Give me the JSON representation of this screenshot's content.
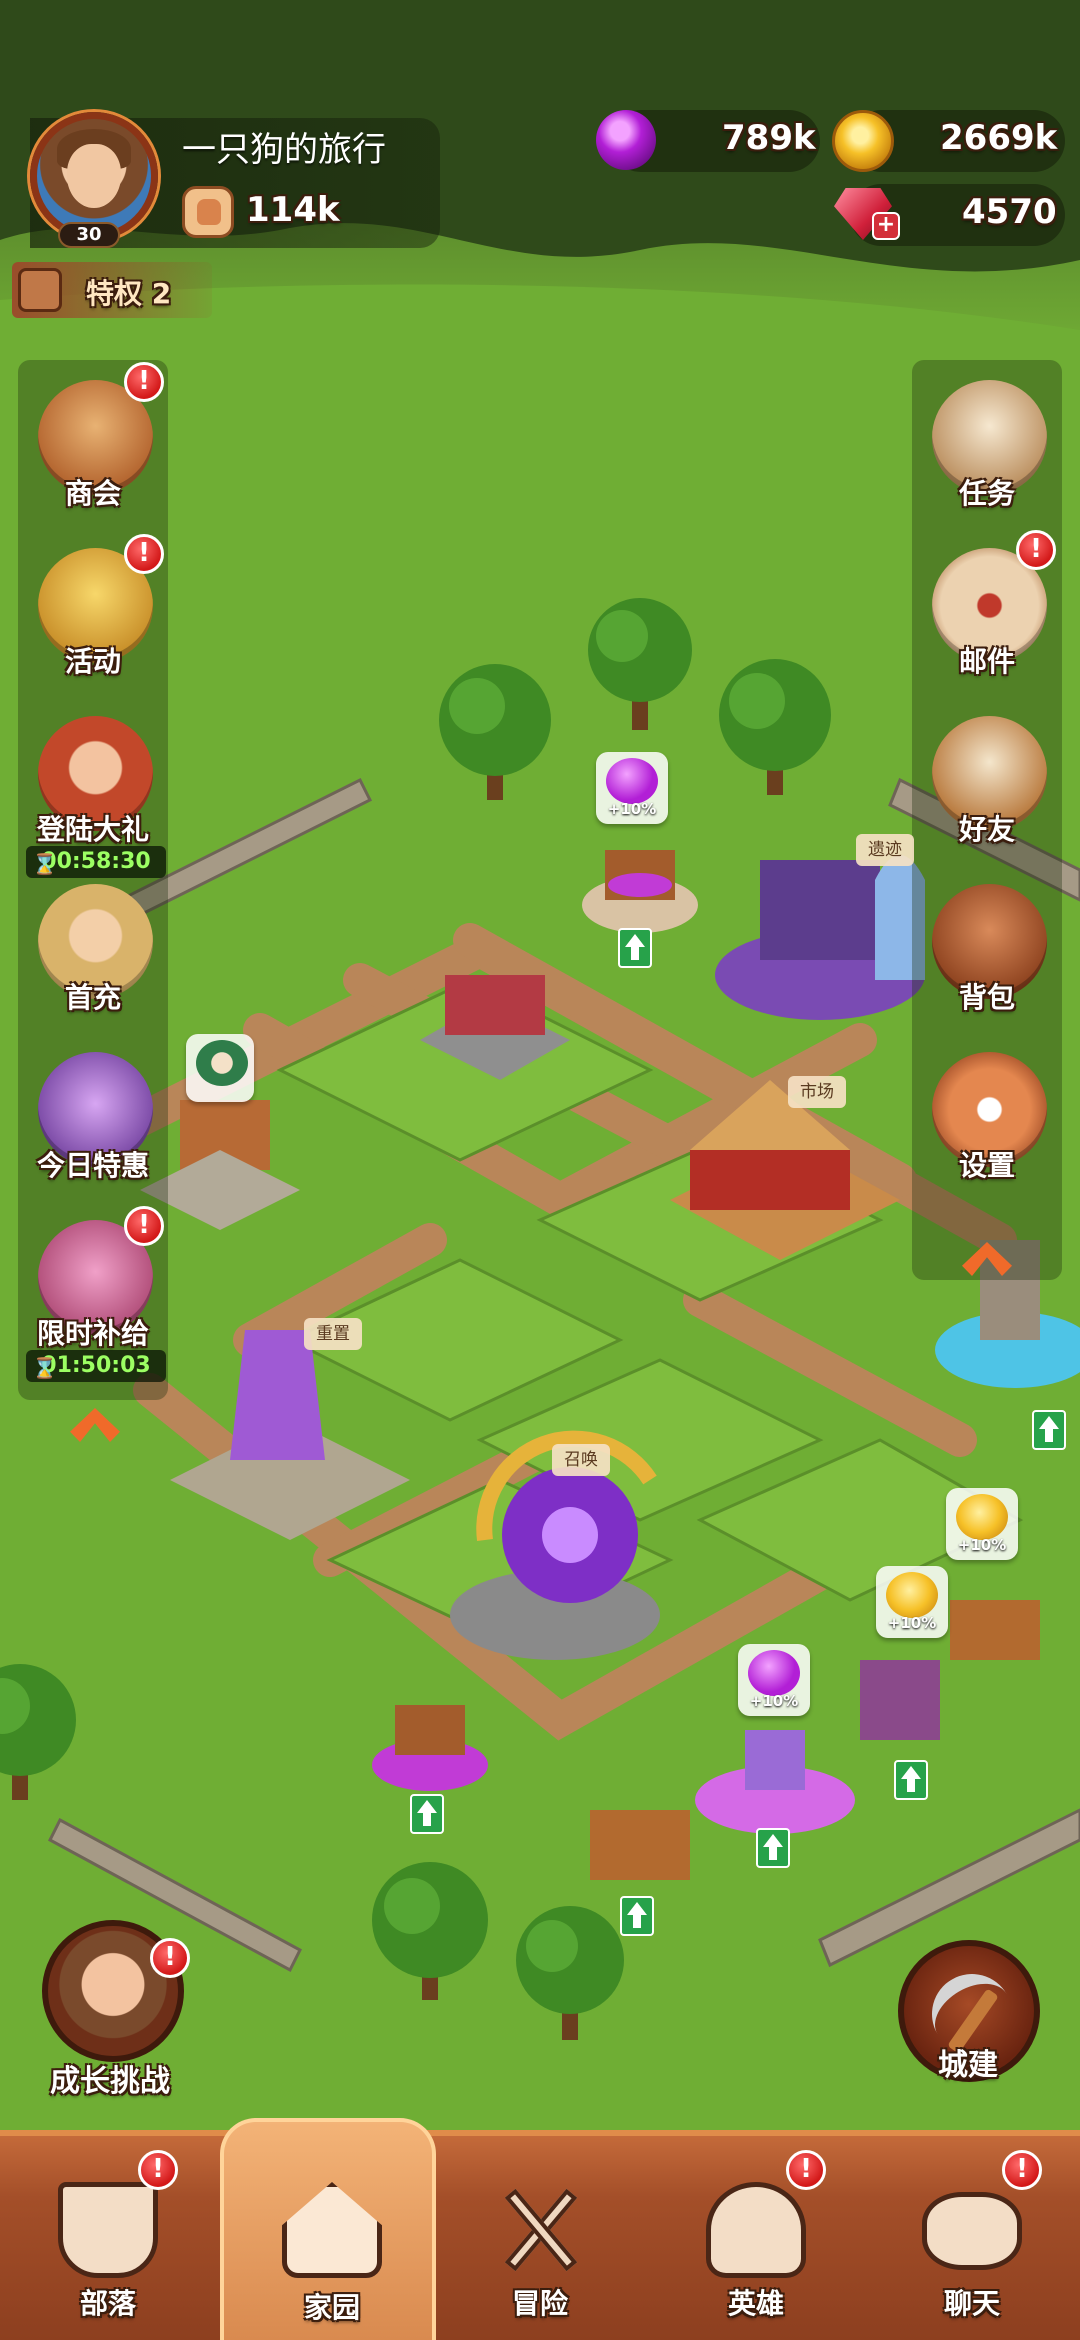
{
  "player": {
    "name": "一只狗的旅行",
    "level": "30",
    "power": "114k"
  },
  "privilege": {
    "label": "特权 2"
  },
  "resources": {
    "elixir": "789k",
    "gold": "2669k",
    "gems": "4570"
  },
  "left_menu": [
    {
      "key": "shop",
      "label": "商会",
      "alert": "!",
      "color": "#b4652f"
    },
    {
      "key": "events",
      "label": "活动",
      "alert": "!",
      "color": "#c9902a"
    },
    {
      "key": "login_gift",
      "label": "登陆大礼",
      "timer": "00:58:30",
      "color": "#c2482a"
    },
    {
      "key": "first_recharge",
      "label": "首充",
      "color": "#d9b36a"
    },
    {
      "key": "daily_deal",
      "label": "今日特惠",
      "color": "#7b4aa6"
    },
    {
      "key": "limited_supply",
      "label": "限时补给",
      "alert": "!",
      "timer": "01:50:03",
      "color": "#b24f7a"
    }
  ],
  "right_menu": [
    {
      "key": "tasks",
      "label": "任务",
      "color": "#e6d2b4"
    },
    {
      "key": "mail",
      "label": "邮件",
      "alert": "!",
      "color": "#d9b090"
    },
    {
      "key": "friends",
      "label": "好友",
      "color": "#c7a27a"
    },
    {
      "key": "backpack",
      "label": "背包",
      "color": "#a8542c"
    },
    {
      "key": "settings",
      "label": "设置",
      "color": "#c9653a"
    }
  ],
  "map_tags": {
    "ruins": "遗迹",
    "market": "市场",
    "reset": "重置",
    "summon": "召唤"
  },
  "map_bonus": {
    "elixir_bonus": "+10%",
    "gold_bonus": "+10%"
  },
  "growth_challenge": {
    "label": "成长挑战",
    "alert": "!"
  },
  "build": {
    "label": "城建"
  },
  "bottom_nav": [
    {
      "key": "tribe",
      "label": "部落",
      "alert": "!"
    },
    {
      "key": "home",
      "label": "家园",
      "active": true
    },
    {
      "key": "adventure",
      "label": "冒险"
    },
    {
      "key": "heroes",
      "label": "英雄",
      "alert": "!"
    },
    {
      "key": "chat",
      "label": "聊天",
      "alert": "!"
    }
  ],
  "colors": {
    "grass": "#5f9b2c",
    "path": "#b4825a",
    "nav_bg": "#a44f29",
    "alert_red": "#d31919"
  }
}
